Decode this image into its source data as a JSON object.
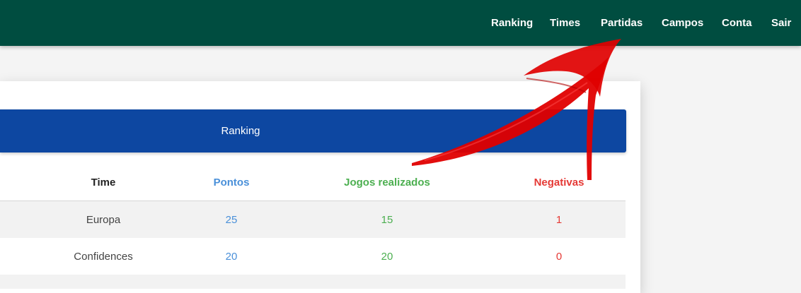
{
  "navbar": {
    "items": [
      {
        "label": "Ranking"
      },
      {
        "label": "Times"
      },
      {
        "label": "Partidas"
      },
      {
        "label": "Campos"
      },
      {
        "label": "Conta"
      },
      {
        "label": "Sair"
      }
    ]
  },
  "card": {
    "title": "Ranking"
  },
  "table": {
    "headers": {
      "time": "Time",
      "pontos": "Pontos",
      "jogos": "Jogos realizados",
      "negativas": "Negativas"
    },
    "rows": [
      {
        "time": "Europa",
        "pontos": "25",
        "jogos": "15",
        "negativas": "1"
      },
      {
        "time": "Confidences",
        "pontos": "20",
        "jogos": "20",
        "negativas": "0"
      }
    ]
  },
  "colors": {
    "navbar": "#004d40",
    "header": "#0d47a1",
    "pontos": "#4a90d9",
    "jogos": "#4caf50",
    "negativas": "#e53935",
    "arrow": "#e00000"
  }
}
